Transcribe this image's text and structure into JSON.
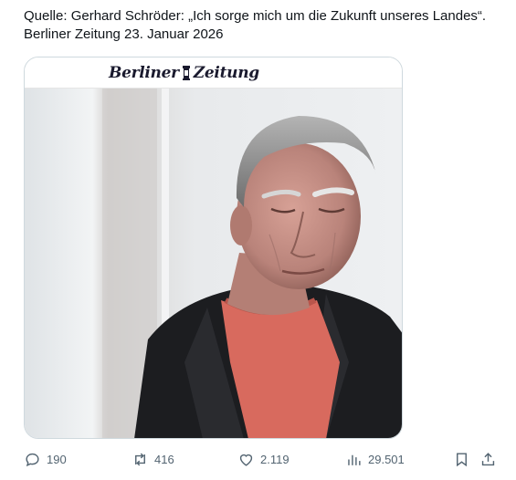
{
  "post": {
    "text_line_1": "Quelle: Gerhard Schröder: „Ich sorge mich um die Zukunft unseres Landes“.",
    "text_line_2": "Berliner Zeitung 23. Januar 2026"
  },
  "media": {
    "masthead_left": "Berliner",
    "masthead_right": "Zeitung",
    "colors": {
      "background": "#e9ecef",
      "jacket": "#1c1d20",
      "sweater": "#d86a5e",
      "skin": "#c98f82",
      "hair": "#8a8a8a"
    }
  },
  "actions": {
    "replies": "190",
    "reposts": "416",
    "likes": "2.119",
    "views": "29.501",
    "icons": [
      "reply-icon",
      "repost-icon",
      "like-icon",
      "views-icon",
      "bookmark-icon",
      "share-icon"
    ]
  }
}
